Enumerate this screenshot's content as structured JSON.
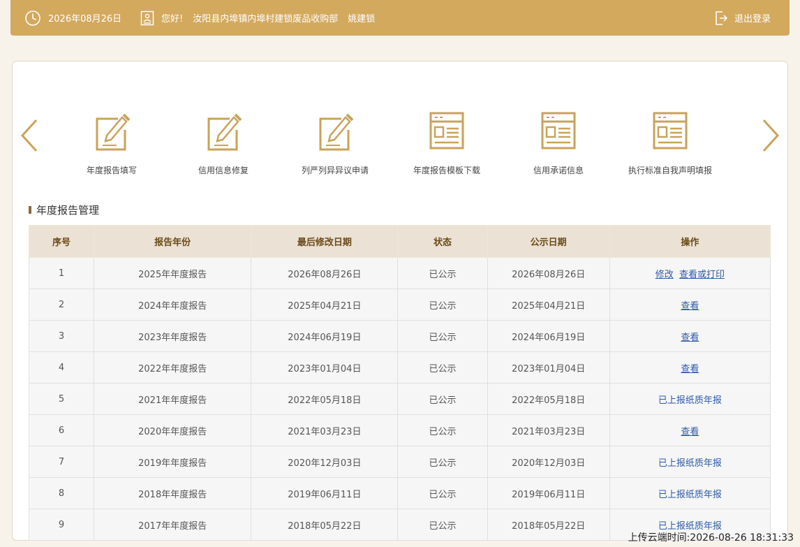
{
  "header": {
    "date": "2026年08月26日",
    "greeting": "您好!",
    "org_name": "汝阳县内埠镇内埠村建锁废品收购部",
    "user_name": "姚建锁",
    "logout_label": "退出登录"
  },
  "tools": [
    {
      "label": "年度报告填写",
      "icon": "edit-icon"
    },
    {
      "label": "信用信息修复",
      "icon": "edit-icon"
    },
    {
      "label": "列严列异异议申请",
      "icon": "edit-icon"
    },
    {
      "label": "年度报告模板下载",
      "icon": "template-icon"
    },
    {
      "label": "信用承诺信息",
      "icon": "template-icon"
    },
    {
      "label": "执行标准自我声明填报",
      "icon": "template-icon"
    }
  ],
  "section": {
    "title": "年度报告管理"
  },
  "table": {
    "headers": [
      "序号",
      "报告年份",
      "最后修改日期",
      "状态",
      "公示日期",
      "操作"
    ],
    "rows": [
      {
        "no": "1",
        "year": "2025年年度报告",
        "modified": "2026年08月26日",
        "status": "已公示",
        "published": "2026年08月26日"
      },
      {
        "no": "2",
        "year": "2024年年度报告",
        "modified": "2025年04月21日",
        "status": "已公示",
        "published": "2025年04月21日"
      },
      {
        "no": "3",
        "year": "2023年年度报告",
        "modified": "2024年06月19日",
        "status": "已公示",
        "published": "2024年06月19日"
      },
      {
        "no": "4",
        "year": "2022年年度报告",
        "modified": "2023年01月04日",
        "status": "已公示",
        "published": "2023年01月04日"
      },
      {
        "no": "5",
        "year": "2021年年度报告",
        "modified": "2022年05月18日",
        "status": "已公示",
        "published": "2022年05月18日"
      },
      {
        "no": "6",
        "year": "2020年年度报告",
        "modified": "2021年03月23日",
        "status": "已公示",
        "published": "2021年03月23日"
      },
      {
        "no": "7",
        "year": "2019年年度报告",
        "modified": "2020年12月03日",
        "status": "已公示",
        "published": "2020年12月03日"
      },
      {
        "no": "8",
        "year": "2018年年度报告",
        "modified": "2019年06月11日",
        "status": "已公示",
        "published": "2019年06月11日"
      },
      {
        "no": "9",
        "year": "2017年年度报告",
        "modified": "2018年05月22日",
        "status": "已公示",
        "published": "2018年05月22日"
      }
    ],
    "actions": {
      "edit": "修改",
      "view_print": "查看或打印",
      "view": "查看",
      "paper_submitted": "已上报纸质年报"
    }
  },
  "footer": {
    "upload_time": "上传云端时间:2026-08-26 18:31:33"
  },
  "colors": {
    "accent": "#d3a95e",
    "icon_gold": "#c9a25a",
    "header_text": "#6b4a18",
    "link": "#2e5aa8"
  }
}
